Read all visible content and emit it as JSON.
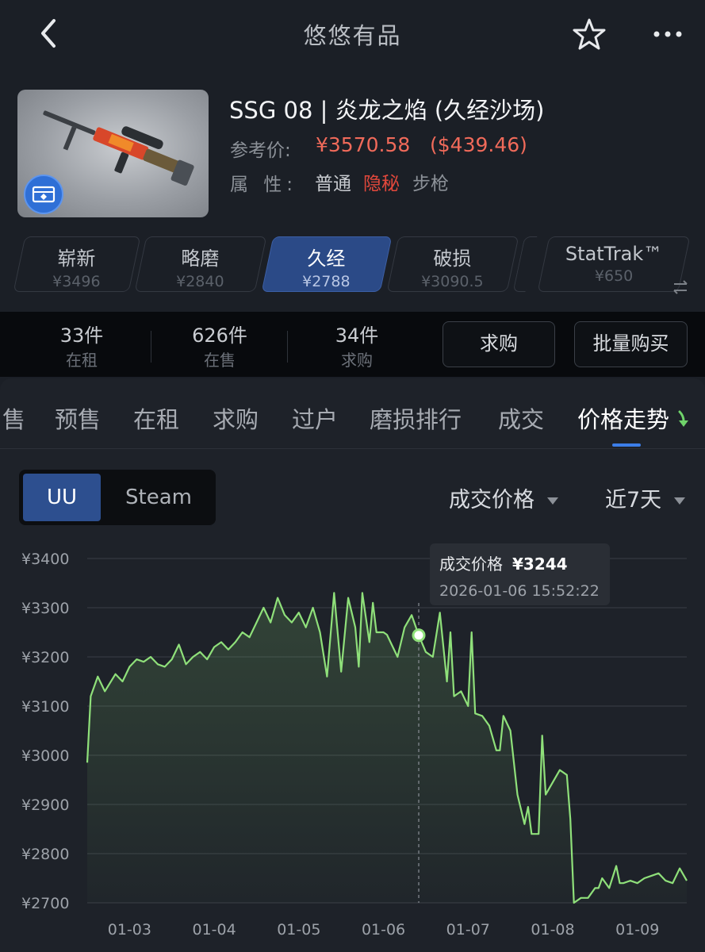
{
  "nav": {
    "title": "悠悠有品"
  },
  "item": {
    "name": "SSG 08 | 炎龙之焰 (久经沙场)",
    "ref_label": "参考价:",
    "ref_price": "¥3570.58",
    "ref_usd": "($439.46)",
    "attr_label": "属 性:",
    "attr_values": [
      "普通",
      "隐秘",
      "步枪"
    ],
    "colors": {
      "price": "#f06a5a",
      "rarity": "#e2483c"
    }
  },
  "wear_tabs": [
    {
      "name": "崭新",
      "price": "¥3496"
    },
    {
      "name": "略磨",
      "price": "¥2840"
    },
    {
      "name": "久经",
      "price": "¥2788",
      "active": true
    },
    {
      "name": "破损",
      "price": "¥3090.5"
    },
    {
      "name": "StatTrak™",
      "price": "¥650"
    }
  ],
  "stats": [
    {
      "count": "33件",
      "label": "在租"
    },
    {
      "count": "626件",
      "label": "在售"
    },
    {
      "count": "34件",
      "label": "求购"
    }
  ],
  "actions": {
    "buy_request": "求购",
    "bulk_buy": "批量购买"
  },
  "tabs": [
    "售",
    "预售",
    "在租",
    "求购",
    "过户",
    "磨损排行",
    "成交",
    "价格走势"
  ],
  "active_tab": "价格走势",
  "source": {
    "uu": "UU",
    "steam": "Steam",
    "selected": "UU"
  },
  "filters": {
    "metric": "成交价格",
    "period": "近7天"
  },
  "tooltip": {
    "label": "成交价格",
    "value": "¥3244",
    "time": "2026-01-06 15:52:22"
  },
  "chart_data": {
    "type": "area",
    "x_tick_labels": [
      "01-03",
      "01-04",
      "01-05",
      "01-06",
      "01-07",
      "01-08",
      "01-09"
    ],
    "y_tick_labels": [
      "¥3400",
      "¥3300",
      "¥3200",
      "¥3100",
      "¥3000",
      "¥2900",
      "¥2800",
      "¥2700"
    ],
    "ylim": [
      2700,
      3400
    ],
    "xlim": [
      "01-02 12:00",
      "01-09 14:00"
    ],
    "grid": true,
    "line_color": "#8fe07a",
    "series": [
      {
        "x": [
          "01-02 12:00",
          "01-02 13:00",
          "01-02 15:00",
          "01-02 17:00",
          "01-02 20:00",
          "01-02 22:00",
          "01-03 00:00",
          "01-03 02:00",
          "01-03 04:00",
          "01-03 06:00",
          "01-03 08:00",
          "01-03 10:00",
          "01-03 12:00",
          "01-03 14:00",
          "01-03 16:00",
          "01-03 18:00",
          "01-03 20:00",
          "01-03 22:00",
          "01-04 00:00",
          "01-04 02:00",
          "01-04 04:00",
          "01-04 06:00",
          "01-04 08:00",
          "01-04 10:00",
          "01-04 12:00",
          "01-04 14:00",
          "01-04 16:00",
          "01-04 18:00",
          "01-04 20:00",
          "01-04 22:00",
          "01-05 00:00",
          "01-05 02:00",
          "01-05 04:00",
          "01-05 06:00",
          "01-05 08:00",
          "01-05 10:00",
          "01-05 12:00",
          "01-05 14:00",
          "01-05 16:00",
          "01-05 17:00",
          "01-05 18:00",
          "01-05 20:00",
          "01-05 21:00",
          "01-05 22:00",
          "01-06 00:00",
          "01-06 01:00",
          "01-06 02:00",
          "01-06 04:00",
          "01-06 06:00",
          "01-06 08:00",
          "01-06 10:00",
          "01-06 12:00",
          "01-06 14:00",
          "01-06 16:00",
          "01-06 18:00",
          "01-06 19:00",
          "01-06 20:00",
          "01-06 22:00",
          "01-07 00:00",
          "01-07 01:00",
          "01-07 02:00",
          "01-07 04:00",
          "01-07 06:00",
          "01-07 08:00",
          "01-07 09:00",
          "01-07 10:00",
          "01-07 12:00",
          "01-07 14:00",
          "01-07 16:00",
          "01-07 17:00",
          "01-07 18:00",
          "01-07 20:00",
          "01-07 21:00",
          "01-07 22:00",
          "01-08 00:00",
          "01-08 02:00",
          "01-08 04:00",
          "01-08 05:00",
          "01-08 06:00",
          "01-08 08:00",
          "01-08 10:00",
          "01-08 12:00",
          "01-08 13:00",
          "01-08 14:00",
          "01-08 16:00",
          "01-08 18:00",
          "01-08 19:00",
          "01-08 20:00",
          "01-08 22:00",
          "01-09 00:00",
          "01-09 02:00",
          "01-09 04:00",
          "01-09 06:00",
          "01-09 08:00",
          "01-09 10:00",
          "01-09 12:00",
          "01-09 14:00"
        ],
        "y": [
          2985,
          3120,
          3160,
          3130,
          3165,
          3150,
          3180,
          3195,
          3190,
          3200,
          3185,
          3180,
          3195,
          3225,
          3185,
          3200,
          3210,
          3195,
          3220,
          3230,
          3215,
          3230,
          3250,
          3240,
          3270,
          3300,
          3270,
          3320,
          3285,
          3270,
          3290,
          3260,
          3300,
          3250,
          3160,
          3330,
          3170,
          3320,
          3260,
          3180,
          3330,
          3230,
          3310,
          3250,
          3250,
          3245,
          3230,
          3200,
          3260,
          3285,
          3244,
          3210,
          3200,
          3290,
          3150,
          3250,
          3120,
          3130,
          3100,
          3250,
          3085,
          3080,
          3060,
          3010,
          3010,
          3080,
          3050,
          2920,
          2860,
          2895,
          2840,
          2840,
          3040,
          2920,
          2945,
          2970,
          2960,
          2870,
          2700,
          2710,
          2710,
          2730,
          2730,
          2750,
          2730,
          2775,
          2740,
          2740,
          2745,
          2740,
          2750,
          2755,
          2760,
          2745,
          2740,
          2770,
          2745
        ]
      }
    ]
  }
}
